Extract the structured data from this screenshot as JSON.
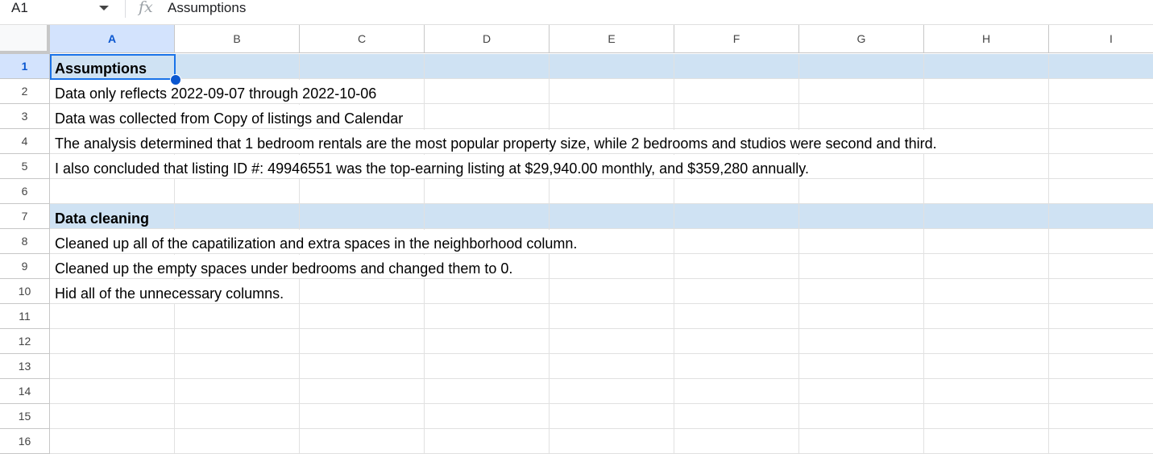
{
  "formula_bar": {
    "name_box": "A1",
    "fx_icon": "fx",
    "formula": "Assumptions"
  },
  "columns": [
    "A",
    "B",
    "C",
    "D",
    "E",
    "F",
    "G",
    "H",
    "I"
  ],
  "rows": [
    "1",
    "2",
    "3",
    "4",
    "5",
    "6",
    "7",
    "8",
    "9",
    "10",
    "11",
    "12",
    "13",
    "14",
    "15",
    "16"
  ],
  "selected_cell": "A1",
  "header_fill": "#cfe2f3",
  "cells": [
    {
      "row": 1,
      "text": "Assumptions",
      "bold": true
    },
    {
      "row": 2,
      "text": "Data only reflects 2022-09-07 through 2022-10-06",
      "bold": false
    },
    {
      "row": 3,
      "text": "Data was collected from Copy of listings and Calendar",
      "bold": false
    },
    {
      "row": 4,
      "text": "The analysis determined that 1 bedroom rentals are the most popular property size, while 2 bedrooms and studios were second and third.",
      "bold": false
    },
    {
      "row": 5,
      "text": "I also concluded that listing ID #: 49946551 was the top-earning listing at $29,940.00 monthly, and $359,280 annually.",
      "bold": false
    },
    {
      "row": 7,
      "text": "Data cleaning",
      "bold": true
    },
    {
      "row": 8,
      "text": "Cleaned up all of the capatilization and extra spaces in the neighborhood column.",
      "bold": false
    },
    {
      "row": 9,
      "text": "Cleaned up the empty spaces under bedrooms and changed them to 0.",
      "bold": false
    },
    {
      "row": 10,
      "text": "Hid all of the unnecessary columns.",
      "bold": false
    }
  ]
}
